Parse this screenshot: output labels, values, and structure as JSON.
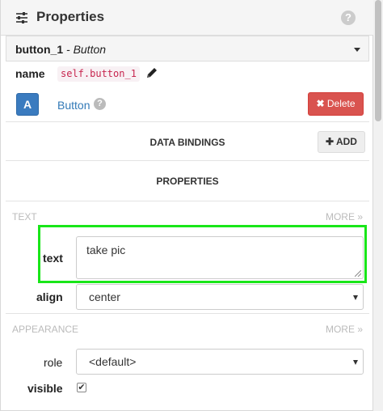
{
  "header": {
    "title": "Properties",
    "help_icon": "question-circle-icon"
  },
  "selector": {
    "component_name": "button_1",
    "separator": " - ",
    "component_type": "Button"
  },
  "name_row": {
    "label": "name",
    "value": "self.button_1",
    "edit_icon": "pencil-icon"
  },
  "component": {
    "icon_letter": "A",
    "type_link": "Button",
    "help_icon": "question-circle-icon",
    "delete_label": "Delete",
    "delete_icon": "times-icon"
  },
  "data_bindings": {
    "title": "DATA BINDINGS",
    "add_label": "ADD",
    "add_icon": "plus-icon"
  },
  "properties": {
    "title": "PROPERTIES"
  },
  "text_group": {
    "title": "TEXT",
    "more": "MORE",
    "fields": {
      "text": {
        "label": "text",
        "value": "take pic"
      },
      "align": {
        "label": "align",
        "value": "center"
      }
    }
  },
  "appearance_group": {
    "title": "APPEARANCE",
    "more": "MORE",
    "fields": {
      "role": {
        "label": "role",
        "value": "<default>"
      },
      "visible": {
        "label": "visible",
        "checked": true
      }
    }
  },
  "colors": {
    "accent": "#3a7bbf",
    "delete": "#d9534f",
    "highlight": "#19e619",
    "code": "#c7254e"
  }
}
